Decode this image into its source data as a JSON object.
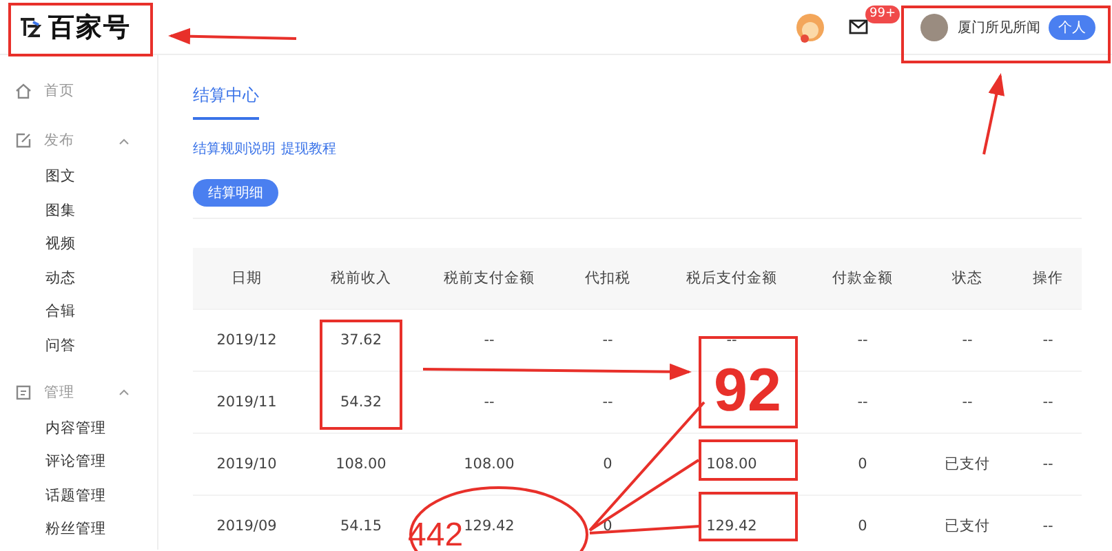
{
  "header": {
    "logo": "百家号",
    "badge": "99+",
    "account_name": "厦门所见所闻",
    "account_type": "个人"
  },
  "sidebar": [
    {
      "kind": "home",
      "label": "首页"
    },
    {
      "kind": "publish",
      "label": "发布",
      "expanded": true,
      "children": [
        "图文",
        "图集",
        "视频",
        "动态",
        "合辑",
        "问答"
      ]
    },
    {
      "kind": "manage",
      "label": "管理",
      "expanded": true,
      "children": [
        "内容管理",
        "评论管理",
        "话题管理",
        "粉丝管理"
      ]
    }
  ],
  "page": {
    "tab": {
      "label": "结算中心",
      "selected": true
    },
    "links": [
      "结算规则说明",
      "提现教程"
    ],
    "button": "结算明细"
  },
  "table": {
    "columns": [
      "日期",
      "税前收入",
      "税前支付金额",
      "代扣税",
      "税后支付金额",
      "付款金额",
      "状态",
      "操作"
    ],
    "rows": [
      [
        "2019/12",
        "37.62",
        "--",
        "--",
        "--",
        "--",
        "--",
        "--"
      ],
      [
        "2019/11",
        "54.32",
        "--",
        "--",
        null,
        "--",
        "--",
        "--"
      ],
      [
        "2019/10",
        "108.00",
        "108.00",
        "0",
        "108.00",
        "0",
        "已支付",
        "--"
      ],
      [
        "2019/09",
        "54.15",
        "129.42",
        "0",
        "129.42",
        "0",
        "已支付",
        "--"
      ]
    ]
  },
  "annotations": [
    "92",
    "442"
  ]
}
